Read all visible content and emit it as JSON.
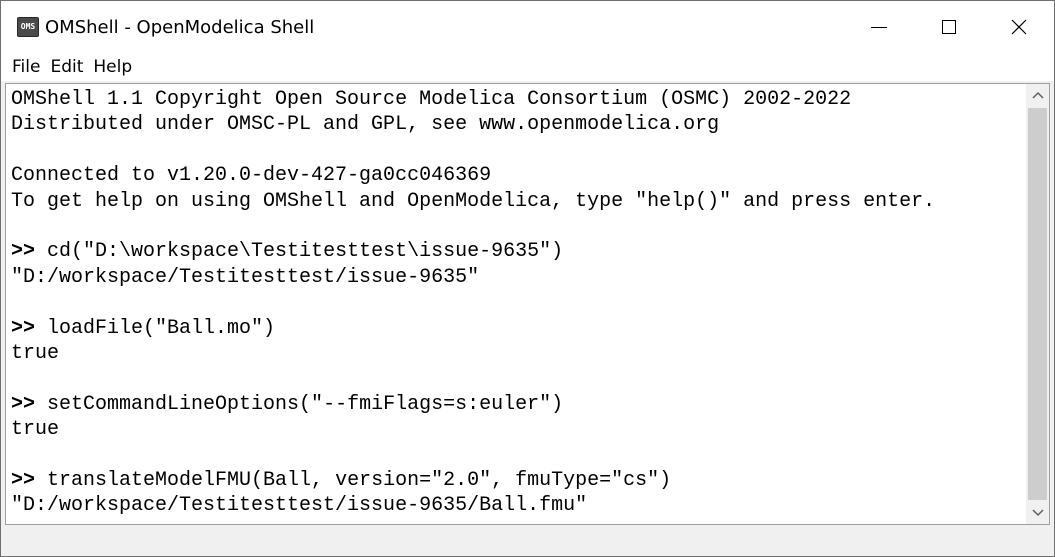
{
  "window": {
    "title": "OMShell - OpenModelica Shell",
    "app_icon_text": "OMS"
  },
  "menu": [
    "File",
    "Edit",
    "Help"
  ],
  "console": {
    "lines": [
      {
        "text": "OMShell 1.1 Copyright Open Source Modelica Consortium (OSMC) 2002-2022"
      },
      {
        "text": "Distributed under OMSC-PL and GPL, see www.openmodelica.org"
      },
      {
        "text": ""
      },
      {
        "text": "Connected to v1.20.0-dev-427-ga0cc046369"
      },
      {
        "text": "To get help on using OMShell and OpenModelica, type \"help()\" and press enter."
      },
      {
        "text": ""
      },
      {
        "prompt": ">>",
        "text": " cd(\"D:\\workspace\\Testitesttest\\issue-9635\")"
      },
      {
        "text": "\"D:/workspace/Testitesttest/issue-9635\""
      },
      {
        "text": ""
      },
      {
        "prompt": ">>",
        "text": " loadFile(\"Ball.mo\")"
      },
      {
        "text": "true"
      },
      {
        "text": ""
      },
      {
        "prompt": ">>",
        "text": " setCommandLineOptions(\"--fmiFlags=s:euler\")"
      },
      {
        "text": "true"
      },
      {
        "text": ""
      },
      {
        "prompt": ">>",
        "text": " translateModelFMU(Ball, version=\"2.0\", fmuType=\"cs\")"
      },
      {
        "text": "\"D:/workspace/Testitesttest/issue-9635/Ball.fmu\""
      }
    ]
  },
  "icons": {
    "minimize": "minimize-icon",
    "maximize": "maximize-icon",
    "close": "close-icon",
    "scroll_up": "chevron-up-icon",
    "scroll_down": "chevron-down-icon"
  }
}
